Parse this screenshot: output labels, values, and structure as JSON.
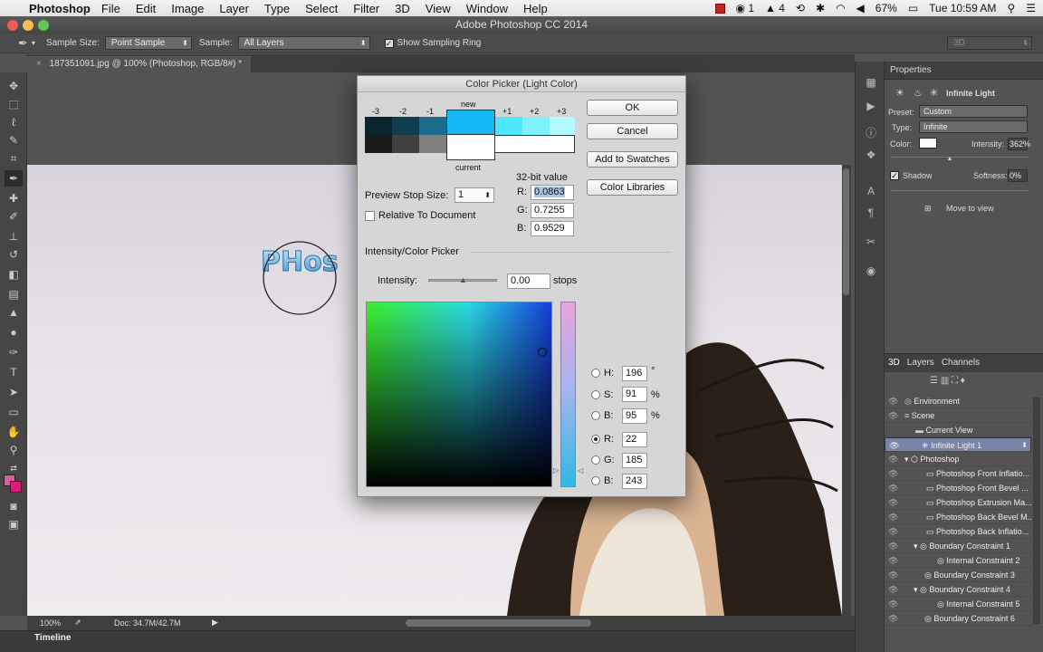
{
  "menubar": {
    "app": "Photoshop",
    "items": [
      "File",
      "Edit",
      "Image",
      "Layer",
      "Type",
      "Select",
      "Filter",
      "3D",
      "View",
      "Window",
      "Help"
    ],
    "status_1": "1",
    "status_2": "4",
    "battery": "67%",
    "clock": "Tue 10:59 AM"
  },
  "window": {
    "title": "Adobe Photoshop CC 2014"
  },
  "options_bar": {
    "sample_size_label": "Sample Size:",
    "sample_size_value": "Point Sample",
    "sample_label": "Sample:",
    "sample_value": "All Layers",
    "sampling_ring_label": "Show Sampling Ring",
    "mode_3d": "3D"
  },
  "document": {
    "tab_title": "187351091.jpg @ 100% (Photoshop, RGB/8#) *",
    "zoom": "100%",
    "doc_info": "Doc: 34.7M/42.7M"
  },
  "timeline_label": "Timeline",
  "color_picker": {
    "title": "Color Picker (Light Color)",
    "new_label": "new",
    "current_label": "current",
    "stops": [
      "-3",
      "-2",
      "-1",
      "+1",
      "+2",
      "+3"
    ],
    "bit_label": "32-bit value",
    "r_label": "R:",
    "r_value": "0.0863",
    "g_label": "G:",
    "g_value": "0.7255",
    "b_label": "B:",
    "b_value": "0.9529",
    "ok": "OK",
    "cancel": "Cancel",
    "add_swatches": "Add to Swatches",
    "color_libraries": "Color Libraries",
    "preview_stop_label": "Preview Stop Size:",
    "preview_stop_value": "1",
    "relative_label": "Relative To Document",
    "section_label": "Intensity/Color Picker",
    "intensity_label": "Intensity:",
    "intensity_value": "0.00",
    "intensity_unit": "stops",
    "h_label": "H:",
    "h_value": "196",
    "h_unit": "°",
    "s_label": "S:",
    "s_value": "91",
    "s_unit": "%",
    "bb_label": "B:",
    "bb_value": "95",
    "bb_unit": "%",
    "rr_label": "R:",
    "rr_value": "22",
    "gg_label": "G:",
    "gg_value": "185",
    "b2_label": "B:",
    "b2_value": "243",
    "new_color": "#16b9f3",
    "current_color": "#ffffff"
  },
  "properties": {
    "tab": "Properties",
    "light_name": "Infinite Light",
    "preset_label": "Preset:",
    "preset_value": "Custom",
    "type_label": "Type:",
    "type_value": "Infinite",
    "color_label": "Color:",
    "intensity_label": "Intensity:",
    "intensity_value": "362%",
    "shadow_label": "Shadow",
    "softness_label": "Softness:",
    "softness_value": "0%",
    "move_to_view": "Move to view"
  },
  "layers_panel": {
    "tabs": [
      "3D",
      "Layers",
      "Channels"
    ],
    "rows": [
      "Environment",
      "Scene",
      "Current View",
      "Infinite Light 1",
      "Photoshop",
      "Photoshop Front Inflatio...",
      "Photoshop Front Bevel ...",
      "Photoshop Extrusion Ma...",
      "Photoshop Back Bevel M...",
      "Photoshop Back Inflatio...",
      "Boundary Constraint 1",
      "Internal Constraint 2",
      "Boundary Constraint 3",
      "Boundary Constraint 4",
      "Internal Constraint 5",
      "Boundary Constraint 6"
    ]
  }
}
